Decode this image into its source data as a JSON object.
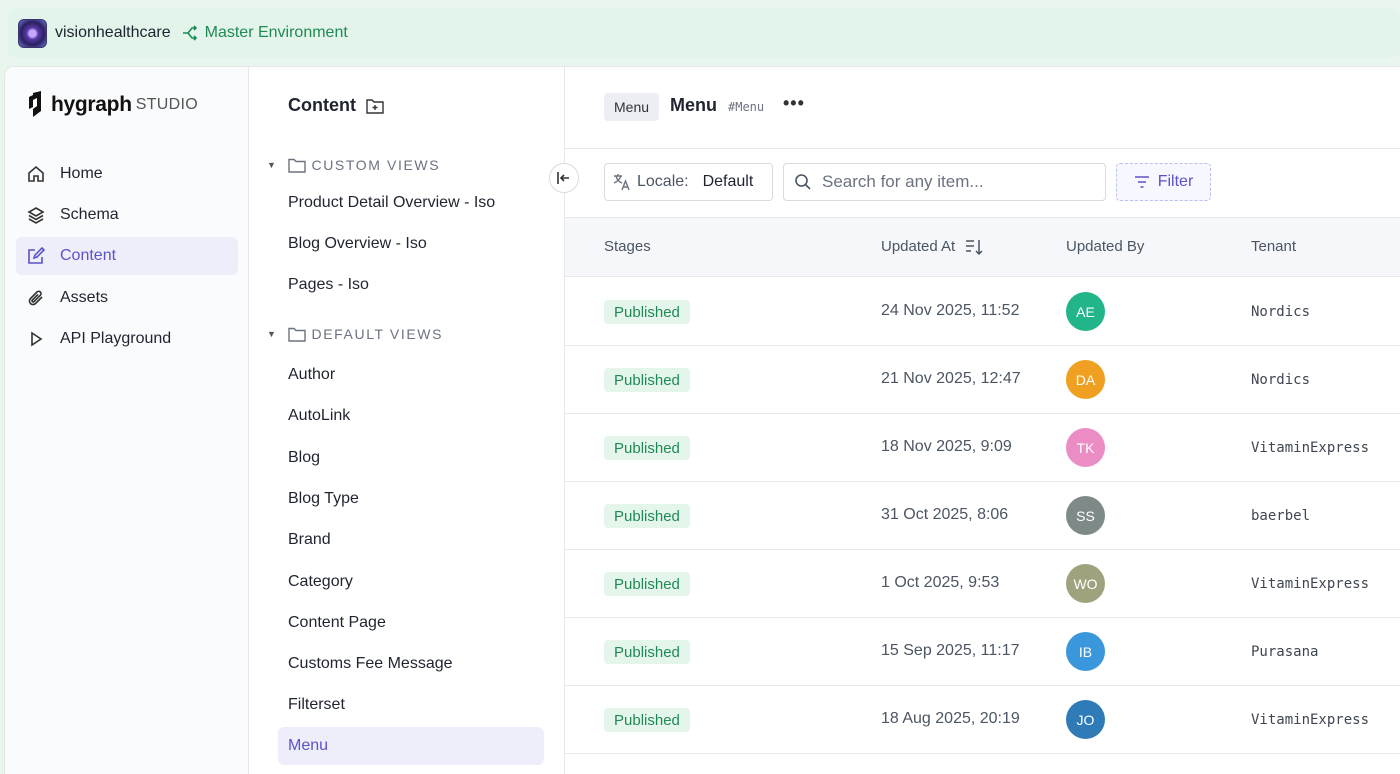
{
  "project": {
    "name": "visionhealthcare",
    "environment": "Master Environment"
  },
  "brand": {
    "logo_word": "hygraph",
    "logo_suffix": "STUDIO",
    "accent": "#5b53c8",
    "success": "#1f8a55"
  },
  "nav": {
    "items": [
      {
        "label": "Home",
        "icon": "home-icon"
      },
      {
        "label": "Schema",
        "icon": "layers-icon"
      },
      {
        "label": "Content",
        "icon": "edit-icon",
        "active": true
      },
      {
        "label": "Assets",
        "icon": "paperclip-icon"
      },
      {
        "label": "API Playground",
        "icon": "play-icon"
      }
    ]
  },
  "views": {
    "title": "Content",
    "custom_header": "CUSTOM VIEWS",
    "custom": [
      "Product Detail Overview - Iso",
      "Blog Overview - Iso",
      "Pages - Iso"
    ],
    "default_header": "DEFAULT VIEWS",
    "default": [
      "Author",
      "AutoLink",
      "Blog",
      "Blog Type",
      "Brand",
      "Category",
      "Content Page",
      "Customs Fee Message",
      "Filterset",
      "Menu"
    ],
    "active": "Menu"
  },
  "main": {
    "chip": "Menu",
    "title": "Menu",
    "api_id": "#Menu",
    "more": "•••",
    "locale_label": "Locale:",
    "locale_value": "Default",
    "search_placeholder": "Search for any item...",
    "filter_label": "Filter",
    "columns": [
      "Stages",
      "Updated At",
      "Updated By",
      "Tenant"
    ],
    "rows": [
      {
        "stage": "Published",
        "updated_at": "24 Nov 2025, 11:52",
        "initials": "AE",
        "color": "#22b58a",
        "tenant": "Nordics"
      },
      {
        "stage": "Published",
        "updated_at": "21 Nov 2025, 12:47",
        "initials": "DA",
        "color": "#f0a020",
        "tenant": "Nordics"
      },
      {
        "stage": "Published",
        "updated_at": "18 Nov 2025, 9:09",
        "initials": "TK",
        "color": "#ec8cc4",
        "tenant": "VitaminExpress"
      },
      {
        "stage": "Published",
        "updated_at": "31 Oct 2025, 8:06",
        "initials": "SS",
        "color": "#7e8a88",
        "tenant": "baerbel"
      },
      {
        "stage": "Published",
        "updated_at": "1 Oct 2025, 9:53",
        "initials": "WO",
        "color": "#a0a27e",
        "tenant": "VitaminExpress"
      },
      {
        "stage": "Published",
        "updated_at": "15 Sep 2025, 11:17",
        "initials": "IB",
        "color": "#3b97dc",
        "tenant": "Purasana"
      },
      {
        "stage": "Published",
        "updated_at": "18 Aug 2025, 20:19",
        "initials": "JO",
        "color": "#2f7bb8",
        "tenant": "VitaminExpress"
      }
    ]
  }
}
